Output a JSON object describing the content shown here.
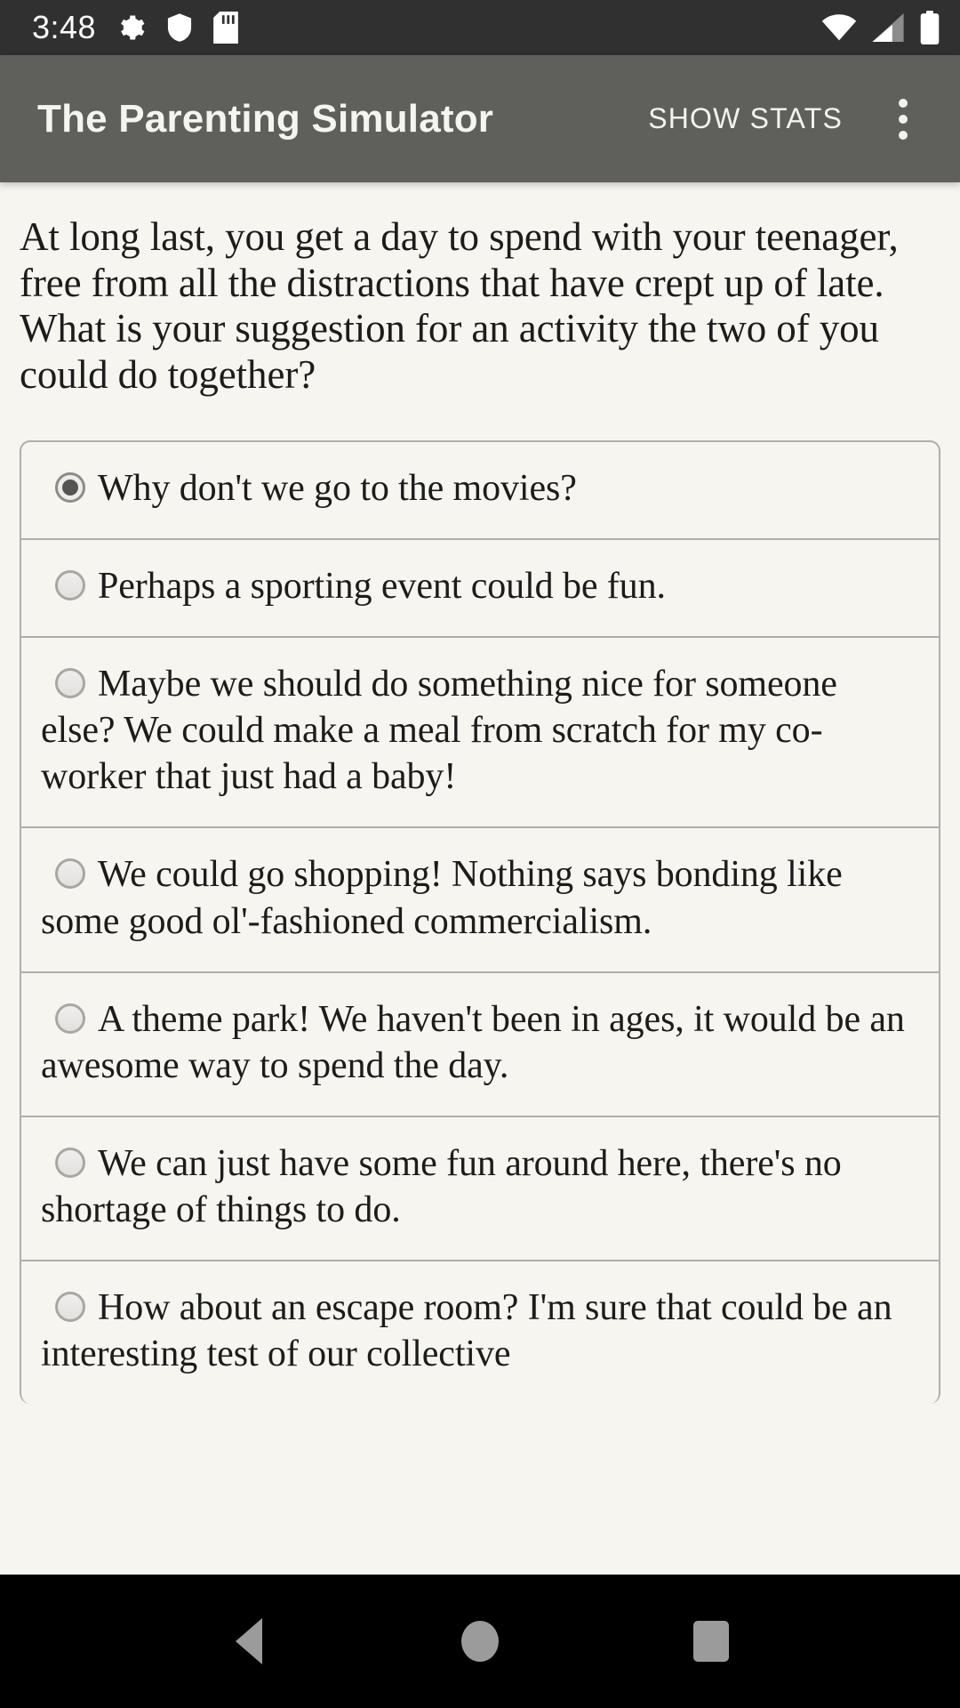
{
  "status_bar": {
    "time": "3:48",
    "left_icons": [
      "gear-icon",
      "shield-icon",
      "sd-card-icon"
    ],
    "right_icons": [
      "wifi-icon",
      "cellular-signal-icon",
      "battery-icon"
    ],
    "background": "#303030"
  },
  "app_bar": {
    "title": "The Parenting Simulator",
    "action_label": "SHOW STATS",
    "overflow_icon": "more-vertical-icon",
    "background": "#5f5f5c",
    "text_color": "#f5f5f0"
  },
  "main": {
    "prompt": "At long last, you get a day to spend with your teenager, free from all the distractions that have crept up of late. What is your suggestion for an activity the two of you could do together?",
    "background": "#f7f5f0",
    "options": [
      {
        "label": "Why don't we go to the movies?",
        "selected": true
      },
      {
        "label": "Perhaps a sporting event could be fun.",
        "selected": false
      },
      {
        "label": "Maybe we should do something nice for someone else? We could make a meal from scratch for my co-worker that just had a baby!",
        "selected": false
      },
      {
        "label": "We could go shopping! Nothing says bonding like some good ol'-fashioned commercialism.",
        "selected": false
      },
      {
        "label": "A theme park! We haven't been in ages, it would be an awesome way to spend the day.",
        "selected": false
      },
      {
        "label": "We can just have some fun around here, there's no shortage of things to do.",
        "selected": false
      },
      {
        "label": "How about an escape room? I'm sure that could be an interesting test of our collective",
        "selected": false
      }
    ]
  },
  "nav_bar": {
    "back_icon": "back-triangle-icon",
    "home_icon": "home-circle-icon",
    "recents_icon": "recents-square-icon",
    "background": "#000000"
  }
}
